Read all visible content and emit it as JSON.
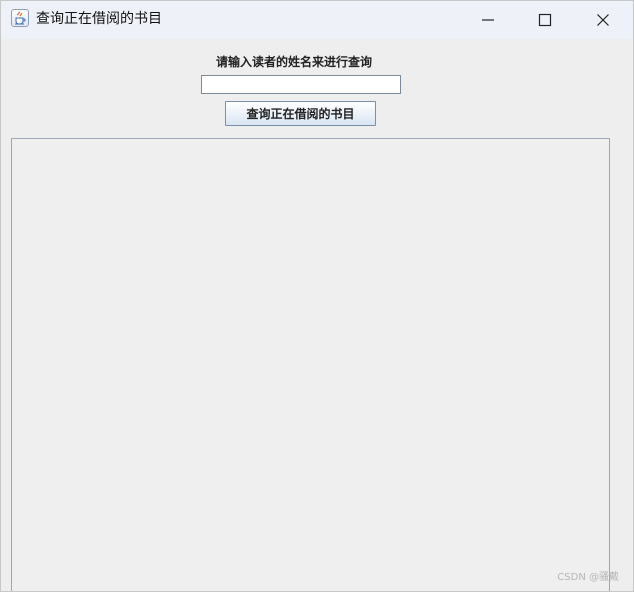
{
  "window": {
    "title": "查询正在借阅的书目",
    "controls": {
      "minimize_icon": "minimize-icon",
      "maximize_icon": "maximize-icon",
      "close_icon": "close-icon"
    }
  },
  "form": {
    "prompt": "请输入读者的姓名来进行查询",
    "reader_name": {
      "value": "",
      "placeholder": ""
    },
    "query_button": "查询正在借阅的书目"
  },
  "results": {
    "content": ""
  },
  "watermark": "CSDN @骚戴",
  "theme": {
    "accent": "#7b8fa8",
    "titlebar": "#eef1f8"
  }
}
